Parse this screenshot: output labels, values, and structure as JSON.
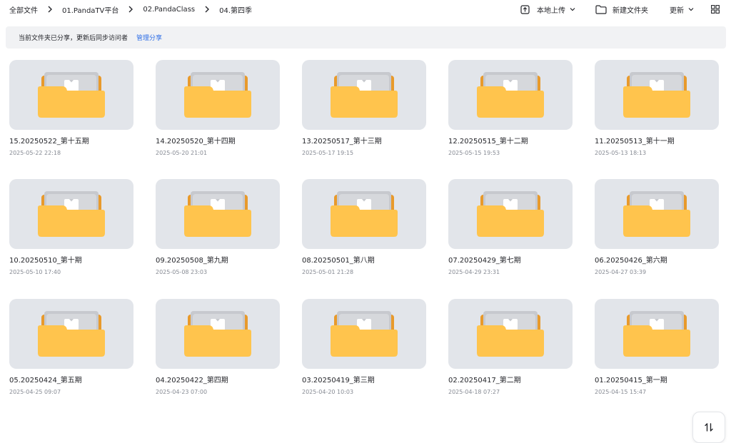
{
  "breadcrumb": [
    "全部文件",
    "01.PandaTV平台",
    "02.PandaClass",
    "04.第四季"
  ],
  "actions": {
    "upload": "本地上传",
    "new_folder": "新建文件夹",
    "sort": "更新"
  },
  "notice": {
    "text": "当前文件夹已分享，更新后同步访问者",
    "link": "管理分享"
  },
  "folders": [
    {
      "name": "15.20250522_第十五期",
      "date": "2025-05-22 22:18"
    },
    {
      "name": "14.20250520_第十四期",
      "date": "2025-05-20 21:01"
    },
    {
      "name": "13.20250517_第十三期",
      "date": "2025-05-17 19:15"
    },
    {
      "name": "12.20250515_第十二期",
      "date": "2025-05-15 19:53"
    },
    {
      "name": "11.20250513_第十一期",
      "date": "2025-05-13 18:13"
    },
    {
      "name": "10.20250510_第十期",
      "date": "2025-05-10 17:40"
    },
    {
      "name": "09.20250508_第九期",
      "date": "2025-05-08 23:03"
    },
    {
      "name": "08.20250501_第八期",
      "date": "2025-05-01 21:28"
    },
    {
      "name": "07.20250429_第七期",
      "date": "2025-04-29 23:31"
    },
    {
      "name": "06.20250426_第六期",
      "date": "2025-04-27 03:39"
    },
    {
      "name": "05.20250424_第五期",
      "date": "2025-04-25 09:07"
    },
    {
      "name": "04.20250422_第四期",
      "date": "2025-04-23 07:00"
    },
    {
      "name": "03.20250419_第三期",
      "date": "2025-04-20 10:03"
    },
    {
      "name": "02.20250417_第二期",
      "date": "2025-04-18 07:27"
    },
    {
      "name": "01.20250415_第一期",
      "date": "2025-04-15 15:47"
    }
  ],
  "icons": {
    "folder": "folder-icon",
    "upload": "upload-icon",
    "new_folder": "new-folder-icon",
    "grid_view": "grid-view-icon",
    "transfer": "transfer-icon"
  },
  "colors": {
    "accent": "#2f6fe6",
    "folder": "#ffc44d",
    "thumb_bg": "#e2e5ea"
  }
}
